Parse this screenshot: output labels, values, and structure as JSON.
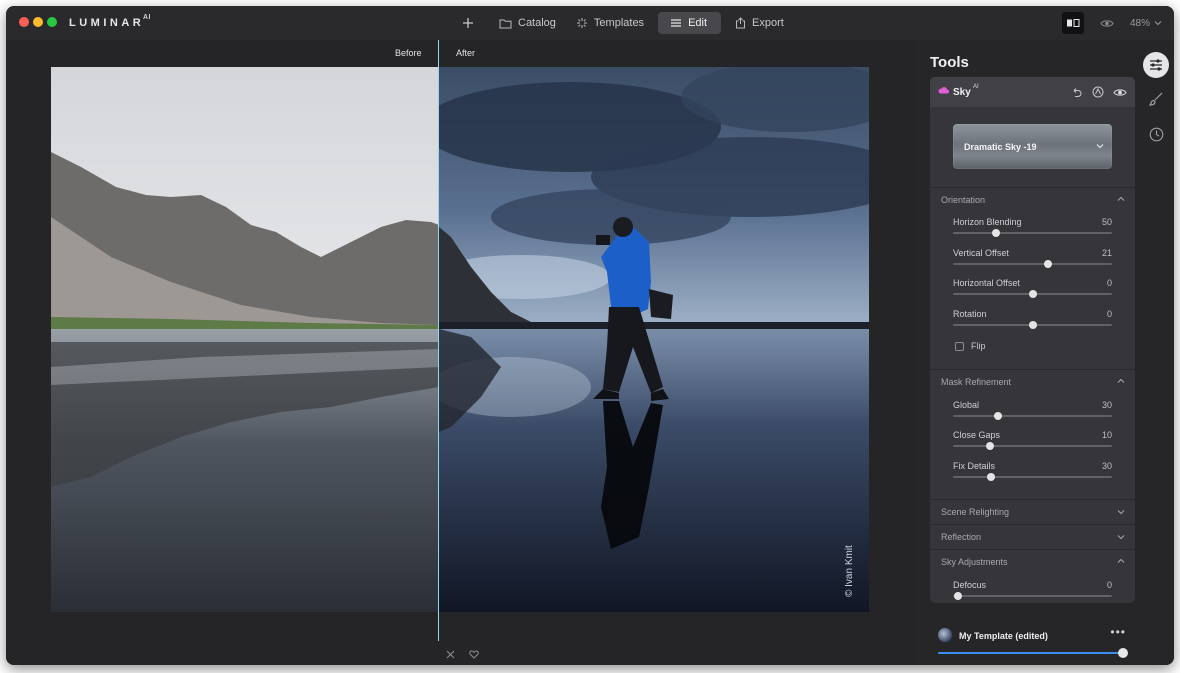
{
  "app": {
    "logo": "LUMINAR",
    "logo_sup": "AI"
  },
  "topnav": {
    "items": [
      {
        "label": "Catalog",
        "icon": "folder-icon"
      },
      {
        "label": "Templates",
        "icon": "sparkle-icon"
      },
      {
        "label": "Edit",
        "icon": "sliders-icon",
        "active": true
      },
      {
        "label": "Export",
        "icon": "share-icon"
      }
    ],
    "zoom": "48%"
  },
  "canvas": {
    "before_label": "Before",
    "after_label": "After",
    "watermark": "© Ivan Kmit"
  },
  "tools": {
    "title": "Tools",
    "active_tool": {
      "name": "Sky",
      "badge": "AI"
    },
    "sky_selection": "Dramatic Sky -19",
    "sections": {
      "orientation": {
        "title": "Orientation",
        "sliders": [
          {
            "label": "Horizon Blending",
            "value": 50,
            "position": 0.27
          },
          {
            "label": "Vertical Offset",
            "value": 21,
            "position": 0.6
          },
          {
            "label": "Horizontal Offset",
            "value": 0,
            "position": 0.5
          },
          {
            "label": "Rotation",
            "value": 0,
            "position": 0.5
          }
        ],
        "flip_label": "Flip"
      },
      "mask_refinement": {
        "title": "Mask Refinement",
        "sliders": [
          {
            "label": "Global",
            "value": 30,
            "position": 0.28
          },
          {
            "label": "Close Gaps",
            "value": 10,
            "position": 0.23
          },
          {
            "label": "Fix Details",
            "value": 30,
            "position": 0.24
          }
        ]
      },
      "scene_relighting": {
        "title": "Scene Relighting"
      },
      "reflection": {
        "title": "Reflection"
      },
      "sky_adjustments": {
        "title": "Sky Adjustments",
        "sliders": [
          {
            "label": "Defocus",
            "value": 0,
            "position": 0.03
          }
        ]
      }
    }
  },
  "template": {
    "name": "My Template (edited)",
    "amount": 1.0
  },
  "colors": {
    "accent": "#3b8df0",
    "split_line": "#8fd8f0",
    "panel": "#35353a",
    "sky_icon": "#e15fd4"
  }
}
